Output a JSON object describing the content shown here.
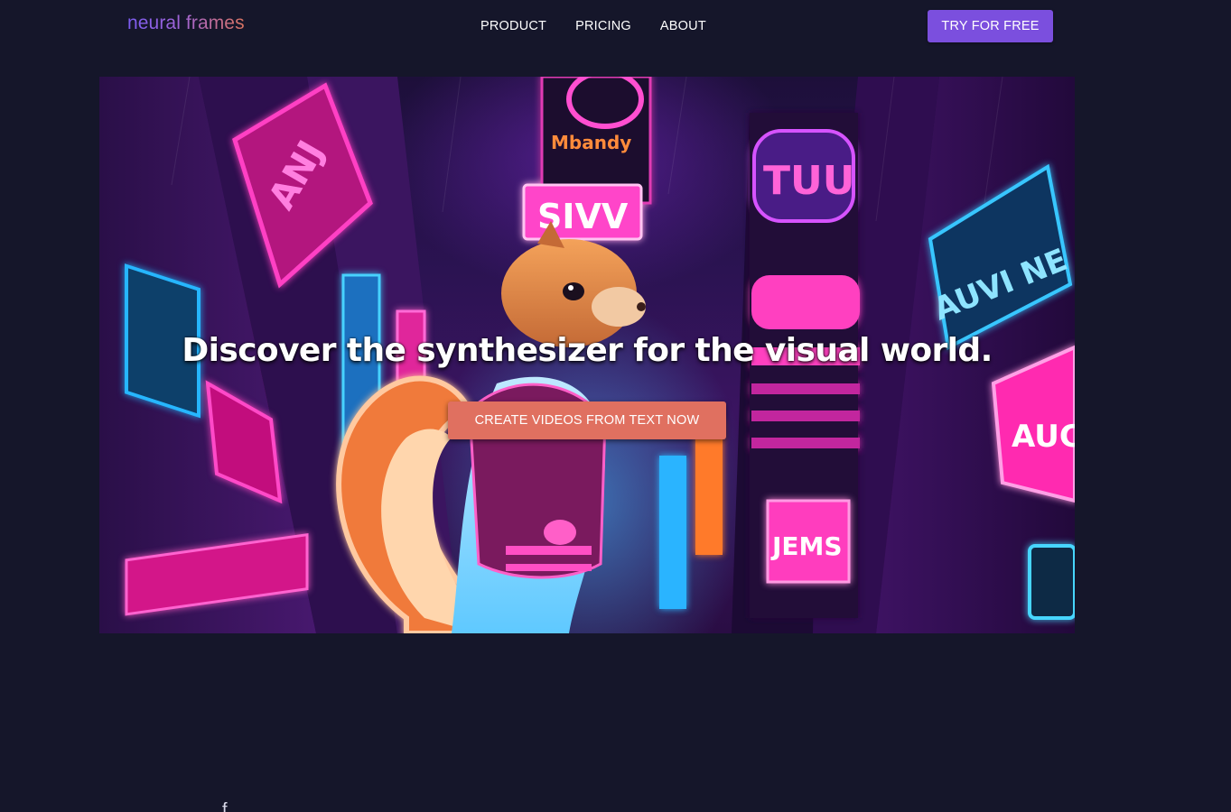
{
  "nav": {
    "logo": "neural frames",
    "links": [
      {
        "label": "PRODUCT"
      },
      {
        "label": "PRICING"
      },
      {
        "label": "ABOUT"
      }
    ],
    "cta_label": "TRY FOR FREE"
  },
  "hero": {
    "headline": "Discover the synthesizer for the visual world.",
    "cta_label": "CREATE VIDEOS FROM TEXT NOW",
    "image_description_icon": "neon-city-squirrel-illustration"
  },
  "below": {
    "partial_glyph": "f"
  },
  "colors": {
    "page_bg": "#15162a",
    "nav_cta_bg": "#7b4fde",
    "hero_cta_bg": "#e07060",
    "logo_gradient_start": "#7b5cf0",
    "logo_gradient_end": "#d9735f"
  }
}
